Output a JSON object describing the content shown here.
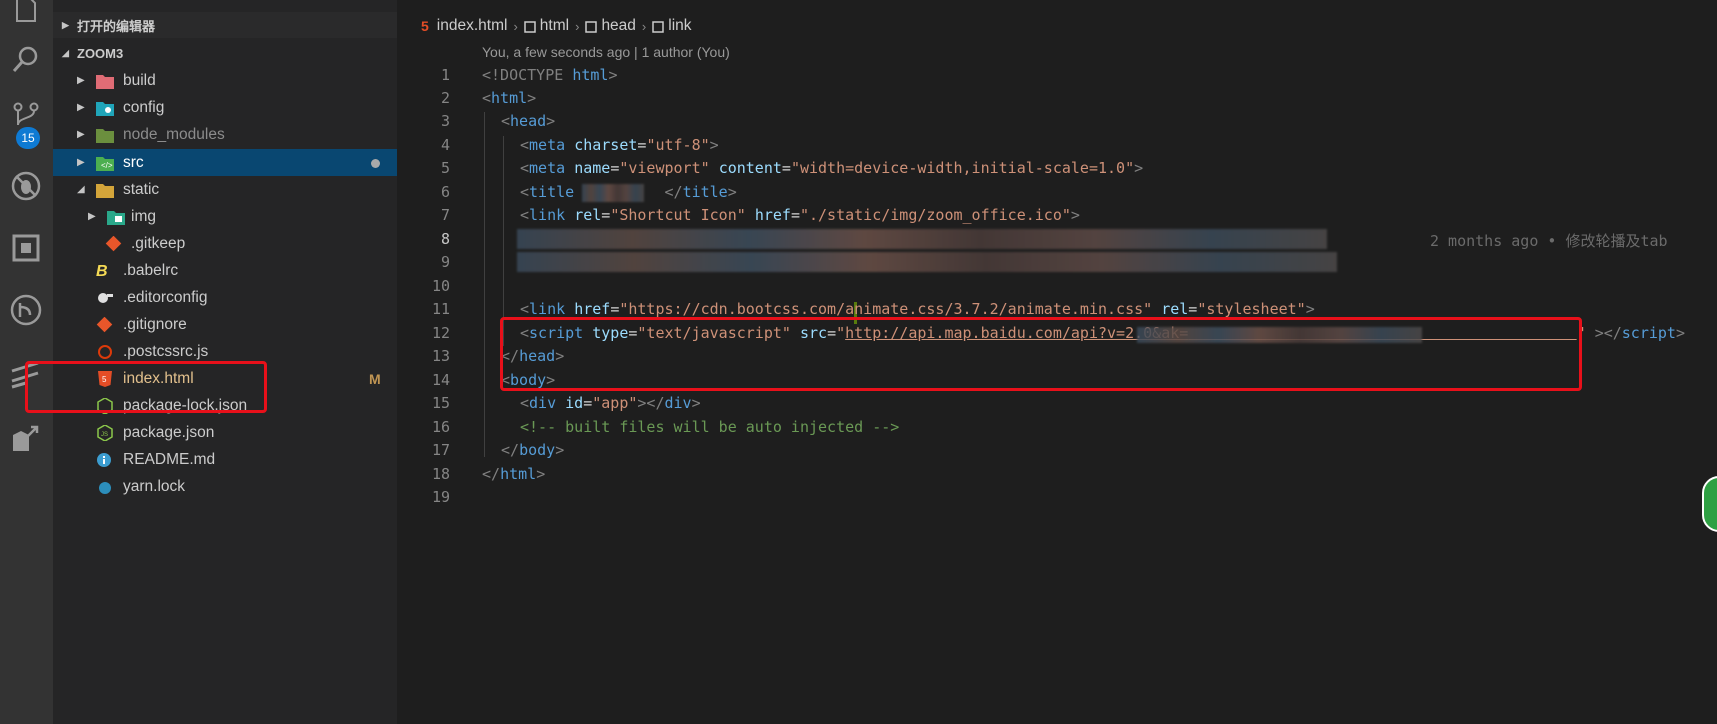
{
  "activity_bar": {
    "scm_badge": "15",
    "icons": [
      "files-icon",
      "search-icon",
      "source-control-icon",
      "debug-icon",
      "extensions-icon",
      "git-lens-icon",
      "remote-icon",
      "deploy-icon"
    ]
  },
  "sidebar": {
    "open_editors_label": "打开的编辑器",
    "project_label": "ZOOM3",
    "items": [
      {
        "label": "build",
        "icon": "folder-red-icon"
      },
      {
        "label": "config",
        "icon": "folder-config-icon"
      },
      {
        "label": "node_modules",
        "icon": "folder-node-icon"
      },
      {
        "label": "src",
        "icon": "folder-src-icon"
      },
      {
        "label": "static",
        "icon": "folder-open-icon"
      },
      {
        "label": "img",
        "icon": "folder-image-icon"
      },
      {
        "label": ".gitkeep",
        "icon": "git-icon"
      },
      {
        "label": ".babelrc",
        "icon": "babel-icon"
      },
      {
        "label": ".editorconfig",
        "icon": "editorconfig-icon"
      },
      {
        "label": ".gitignore",
        "icon": "git-icon"
      },
      {
        "label": ".postcssrc.js",
        "icon": "postcss-icon"
      },
      {
        "label": "index.html",
        "icon": "html-icon",
        "status": "M"
      },
      {
        "label": "package-lock.json",
        "icon": "nodejs-icon"
      },
      {
        "label": "package.json",
        "icon": "nodejs-icon"
      },
      {
        "label": "README.md",
        "icon": "info-icon"
      },
      {
        "label": "yarn.lock",
        "icon": "yarn-icon"
      }
    ]
  },
  "editor": {
    "breadcrumb": [
      "index.html",
      "html",
      "head",
      "link"
    ],
    "blame_header": "You, a few seconds ago | 1 author (You)",
    "line_numbers": [
      "1",
      "2",
      "3",
      "4",
      "5",
      "6",
      "7",
      "8",
      "9",
      "10",
      "11",
      "12",
      "13",
      "14",
      "15",
      "16",
      "17",
      "18",
      "19"
    ],
    "inline_blame": "2 months ago • 修改轮播及tab",
    "code": {
      "l1": {
        "doctype": "<!DOCTYPE",
        "html": "html"
      },
      "l2": {
        "tag": "html"
      },
      "l3": {
        "tag": "head"
      },
      "l4": {
        "tag": "meta",
        "attr": "charset",
        "val": "\"utf-8\""
      },
      "l5": {
        "tag": "meta",
        "attr1": "name",
        "val1": "\"viewport\"",
        "attr2": "content",
        "val2": "\"width=device-width,initial-scale=1.0\""
      },
      "l6": {
        "tag": "title",
        "close": "title"
      },
      "l7": {
        "tag": "link",
        "attr1": "rel",
        "val1": "\"Shortcut Icon\"",
        "attr2": "href",
        "val2": "\"./static/img/zoom_office.ico\""
      },
      "l11": {
        "tag": "link",
        "attr1": "href",
        "val1": "\"https://cdn.bootcss.com/animate.css/3.7.2/animate.min.css\"",
        "attr2": "rel",
        "val2": "\"stylesheet\""
      },
      "l12": {
        "tag": "script",
        "attr1": "type",
        "val1": "\"text/javascript\"",
        "attr2": "src",
        "val2": "http://api.map.baidu.com/api?v=2.0&ak=",
        "close": "script"
      },
      "l13": {
        "tag": "head"
      },
      "l14": {
        "tag": "body"
      },
      "l15": {
        "tag": "div",
        "attr": "id",
        "val": "\"app\"",
        "close": "div"
      },
      "l16": {
        "comment": "<!-- built files will be auto injected -->"
      },
      "l17": {
        "tag": "body"
      },
      "l18": {
        "tag": "html"
      }
    }
  },
  "colors": {
    "annotation_red": "#e8101a",
    "selection": "#094771",
    "tag": "#569cd6",
    "attribute": "#9cdcfe",
    "string": "#ce9178",
    "comment": "#6a9955"
  }
}
